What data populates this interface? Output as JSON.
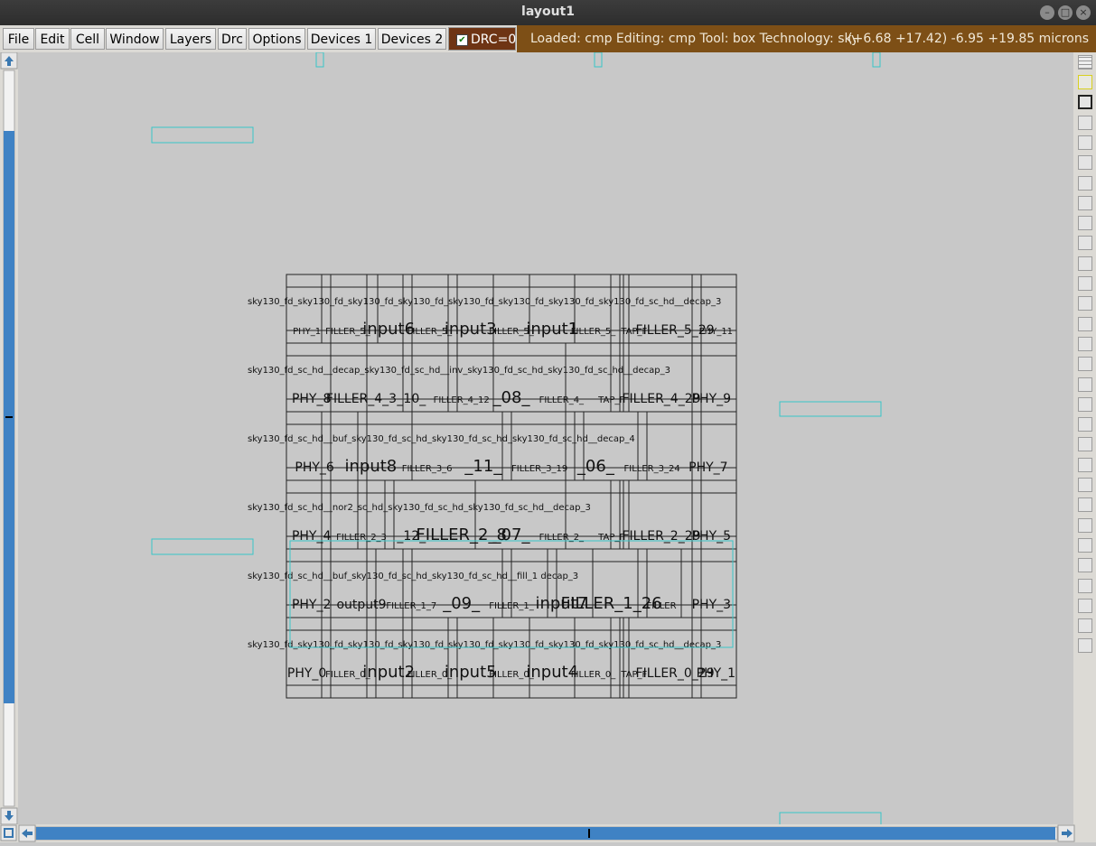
{
  "window": {
    "title": "layout1"
  },
  "menu": [
    {
      "label": "File",
      "name": "menu-file"
    },
    {
      "label": "Edit",
      "name": "menu-edit"
    },
    {
      "label": "Cell",
      "name": "menu-cell"
    },
    {
      "label": "Window",
      "name": "menu-window"
    },
    {
      "label": "Layers",
      "name": "menu-layers"
    },
    {
      "label": "Drc",
      "name": "menu-drc"
    },
    {
      "label": "Options",
      "name": "menu-options"
    },
    {
      "label": "Devices 1",
      "name": "menu-devices-1"
    },
    {
      "label": "Devices 2",
      "name": "menu-devices-2"
    }
  ],
  "drc": {
    "label": "DRC=0",
    "checked": true
  },
  "status": {
    "text": "Loaded: cmp Editing: cmp Tool: box  Technology: sky130",
    "coords": "(+6.68 +17.42) -6.95 +19.85 microns"
  },
  "layout": {
    "rows": [
      {
        "top_label": "sky130_fd_sky130_fd_sky130_fd_sky130_fd_sky130_fd_sky130_fd_sky130_fd_sky130_fd_sc_hd__decap_3",
        "cells": [
          {
            "text": "PHY_1",
            "size": "s"
          },
          {
            "text": "FILLER_5_",
            "size": "s"
          },
          {
            "text": "input6",
            "size": "l"
          },
          {
            "text": "FILLER_5_",
            "size": "s"
          },
          {
            "text": "input3",
            "size": "l"
          },
          {
            "text": "FILLER_5_",
            "size": "s"
          },
          {
            "text": "input1",
            "size": "l"
          },
          {
            "text": "FILLER_5_",
            "size": "s"
          },
          {
            "text": "TAP_F",
            "size": "s"
          },
          {
            "text": "FILLER_5_29",
            "size": "m"
          },
          {
            "text": "PHY_11",
            "size": "s"
          }
        ]
      },
      {
        "top_label": "sky130_fd_sc_hd__decap_sky130_fd_sc_hd__inv_sky130_fd_sc_hd_sky130_fd_sc_hd__decap_3",
        "cells": [
          {
            "text": "PHY_8",
            "size": "m"
          },
          {
            "text": "FILLER_4_3",
            "size": "m"
          },
          {
            "text": "_10_",
            "size": "m"
          },
          {
            "text": "FILLER_4_12",
            "size": "s"
          },
          {
            "text": "_08_",
            "size": "l"
          },
          {
            "text": "FILLER_4_",
            "size": "s"
          },
          {
            "text": "TAP_F",
            "size": "s"
          },
          {
            "text": "FILLER_4_29",
            "size": "m"
          },
          {
            "text": "PHY_9",
            "size": "m"
          }
        ]
      },
      {
        "top_label": "sky130_fd_sc_hd__buf_sky130_fd_sc_hd_sky130_fd_sc_hd_sky130_fd_sc_hd__decap_4",
        "cells": [
          {
            "text": "PHY_6",
            "size": "m"
          },
          {
            "text": "input8",
            "size": "l"
          },
          {
            "text": "FILLER_3_6",
            "size": "s"
          },
          {
            "text": "_11_",
            "size": "l"
          },
          {
            "text": "FILLER_3_19",
            "size": "s"
          },
          {
            "text": "_06_",
            "size": "l"
          },
          {
            "text": "FILLER_3_24",
            "size": "s"
          },
          {
            "text": "PHY_7",
            "size": "m"
          }
        ]
      },
      {
        "top_label": "sky130_fd_sc_hd__nor2_sc_hd_sky130_fd_sc_hd_sky130_fd_sc_hd__decap_3",
        "cells": [
          {
            "text": "PHY_4",
            "size": "m"
          },
          {
            "text": "FILLER_2_3",
            "size": "s"
          },
          {
            "text": "_12_",
            "size": "m"
          },
          {
            "text": "FILLER_2_8",
            "size": "l"
          },
          {
            "text": "_07_",
            "size": "l"
          },
          {
            "text": "FILLER_2_",
            "size": "s"
          },
          {
            "text": "TAP_F",
            "size": "s"
          },
          {
            "text": "FILLER_2_29",
            "size": "m"
          },
          {
            "text": "PHY_5",
            "size": "m"
          }
        ]
      },
      {
        "top_label": "sky130_fd_sc_hd__buf_sky130_fd_sc_hd_sky130_fd_sc_hd__fill_1 decap_3",
        "cells": [
          {
            "text": "PHY_2",
            "size": "m"
          },
          {
            "text": "output9",
            "size": "m"
          },
          {
            "text": "FILLER_1_7",
            "size": "s"
          },
          {
            "text": "_09_",
            "size": "l"
          },
          {
            "text": "FILLER_1_",
            "size": "s"
          },
          {
            "text": "input7",
            "size": "l"
          },
          {
            "text": "FILLER_1_26",
            "size": "l"
          },
          {
            "text": "FILLER",
            "size": "s"
          },
          {
            "text": "PHY_3",
            "size": "m"
          }
        ]
      },
      {
        "top_label": "sky130_fd_sky130_fd_sky130_fd_sky130_fd_sky130_fd_sky130_fd_sky130_fd_sky130_fd_sc_hd__decap_3",
        "cells": [
          {
            "text": "PHY_0",
            "size": "m"
          },
          {
            "text": "FILLER_0_",
            "size": "s"
          },
          {
            "text": "input2",
            "size": "l"
          },
          {
            "text": "FILLER_0_",
            "size": "s"
          },
          {
            "text": "input5",
            "size": "l"
          },
          {
            "text": "FILLER_0_",
            "size": "s"
          },
          {
            "text": "input4",
            "size": "l"
          },
          {
            "text": "FILLER_0_",
            "size": "s"
          },
          {
            "text": "TAP_F",
            "size": "s"
          },
          {
            "text": "FILLER_0_29",
            "size": "m"
          },
          {
            "text": "PHY_1",
            "size": "m"
          }
        ]
      }
    ]
  }
}
